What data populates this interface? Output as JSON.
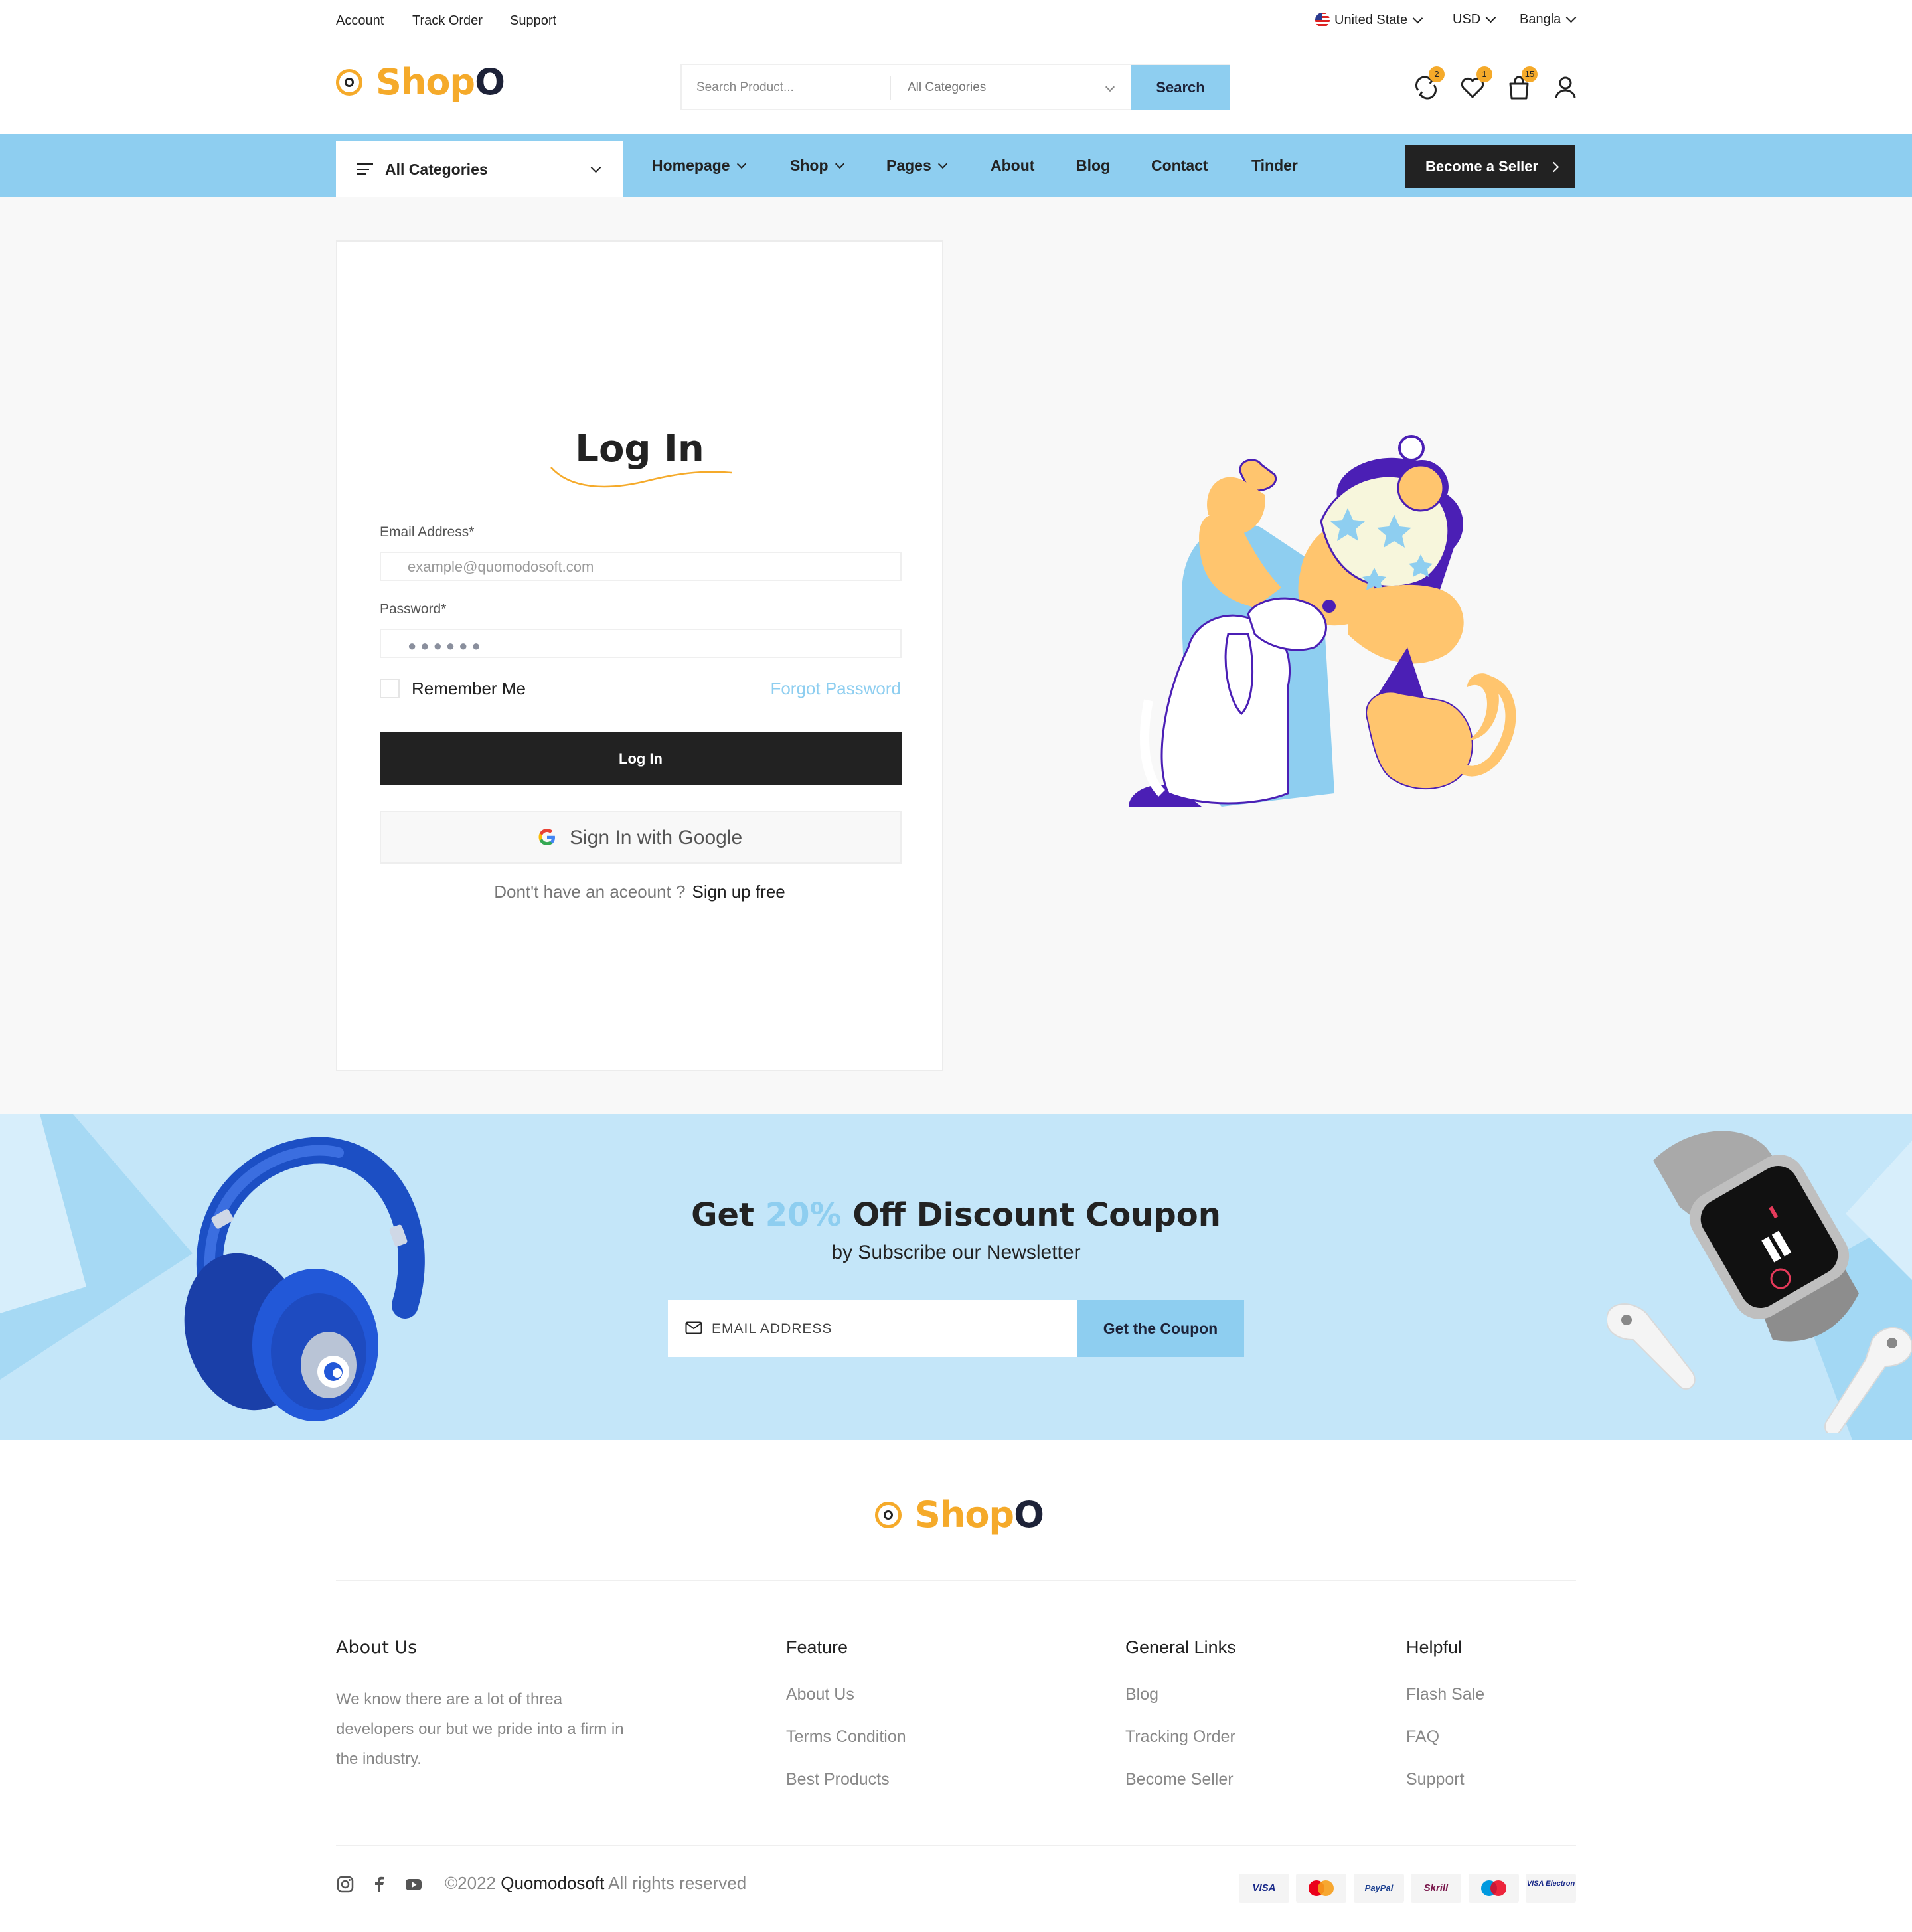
{
  "topbar": {
    "links": [
      "Account",
      "Track Order",
      "Support"
    ],
    "country": "United State",
    "currency": "USD",
    "language": "Bangla"
  },
  "brand": {
    "name_part1": "Shop",
    "name_part2": "O",
    "accent_color": "#F5AA2A",
    "dark_color": "#1d2238",
    "sky_color": "#8ECEF0"
  },
  "search": {
    "placeholder": "Search Product...",
    "category": "All Categories",
    "button": "Search"
  },
  "header_icons": {
    "compare": {
      "icon": "compare-icon",
      "count": "2"
    },
    "wishlist": {
      "icon": "heart-icon",
      "count": "1"
    },
    "cart": {
      "icon": "bag-icon",
      "count": "15"
    },
    "account": {
      "icon": "user-icon"
    }
  },
  "nav": {
    "all_categories": "All Categories",
    "items": [
      "Homepage",
      "Shop",
      "Pages",
      "About",
      "Blog",
      "Contact",
      "Tinder"
    ],
    "seller_button": "Become a Seller"
  },
  "login": {
    "title": "Log In",
    "email_label": "Email Address*",
    "email_placeholder": "example@quomodosoft.com",
    "password_label": "Password*",
    "password_value": "●●●●●●",
    "remember": "Remember Me",
    "forgot": "Forgot Password",
    "submit": "Log In",
    "google": "Sign In with Google",
    "signup_question": "Dont't have an aceount ?",
    "signup_link": "Sign up free"
  },
  "newsletter": {
    "title_pre": "Get",
    "title_pct": "20%",
    "title_post": "Off Discount Coupon",
    "subtitle": "by Subscribe our Newsletter",
    "placeholder": "EMAIL ADDRESS",
    "button": "Get the Coupon"
  },
  "footer": {
    "about_heading": "About Us",
    "about_text": "We know there are a lot of threa developers our but we pride into a firm in the industry.",
    "columns": [
      {
        "heading": "Feature",
        "links": [
          "About Us",
          "Terms Condition",
          "Best Products"
        ]
      },
      {
        "heading": "General Links",
        "links": [
          "Blog",
          "Tracking Order",
          "Become Seller"
        ]
      },
      {
        "heading": "Helpful",
        "links": [
          "Flash Sale",
          "FAQ",
          "Support"
        ]
      }
    ],
    "social": [
      "instagram-icon",
      "facebook-icon",
      "youtube-icon"
    ],
    "copyright_year": "©2022",
    "copyright_company": "Quomodosoft",
    "copyright_rest": "All rights reserved",
    "payments": [
      "VISA",
      "Mastercard",
      "PayPal",
      "Skrill",
      "Maestro",
      "VISA Electron"
    ]
  }
}
